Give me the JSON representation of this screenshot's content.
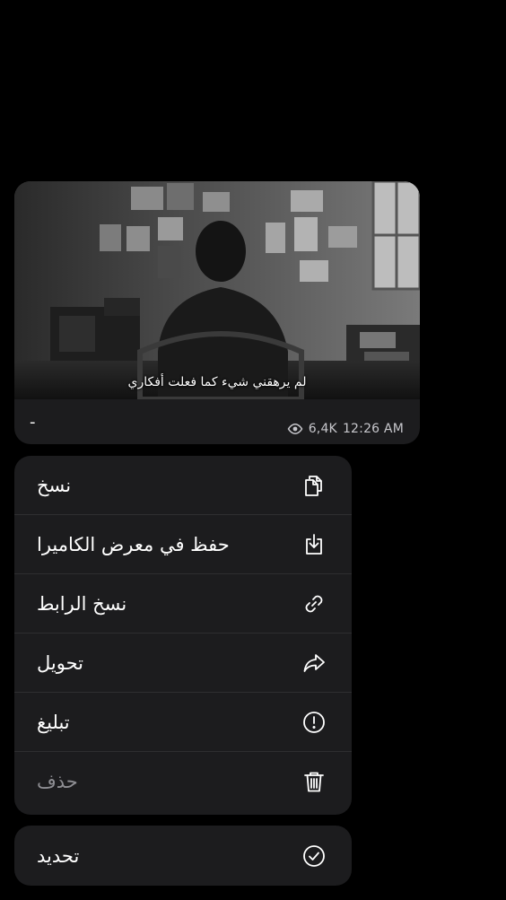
{
  "message": {
    "subtitle": "لم يرهقني شيء كما فعلت أفكاري",
    "caption": "-",
    "views": "6,4K",
    "time": "12:26 AM",
    "views_icon": "eye-icon"
  },
  "menu": {
    "items": [
      {
        "label": "نسخ",
        "icon": "copy-icon"
      },
      {
        "label": "حفظ في معرض الكاميرا",
        "icon": "download-icon"
      },
      {
        "label": "نسخ الرابط",
        "icon": "link-icon"
      },
      {
        "label": "تحويل",
        "icon": "share-arrow-icon"
      },
      {
        "label": "تبليغ",
        "icon": "alert-circle-icon"
      },
      {
        "label": "حذف",
        "icon": "trash-icon"
      }
    ]
  },
  "select": {
    "label": "تحديد",
    "icon": "check-circle-icon"
  },
  "colors": {
    "background": "#000000",
    "surface": "#1c1c1e",
    "text": "#ffffff",
    "muted": "#8e8e93"
  }
}
